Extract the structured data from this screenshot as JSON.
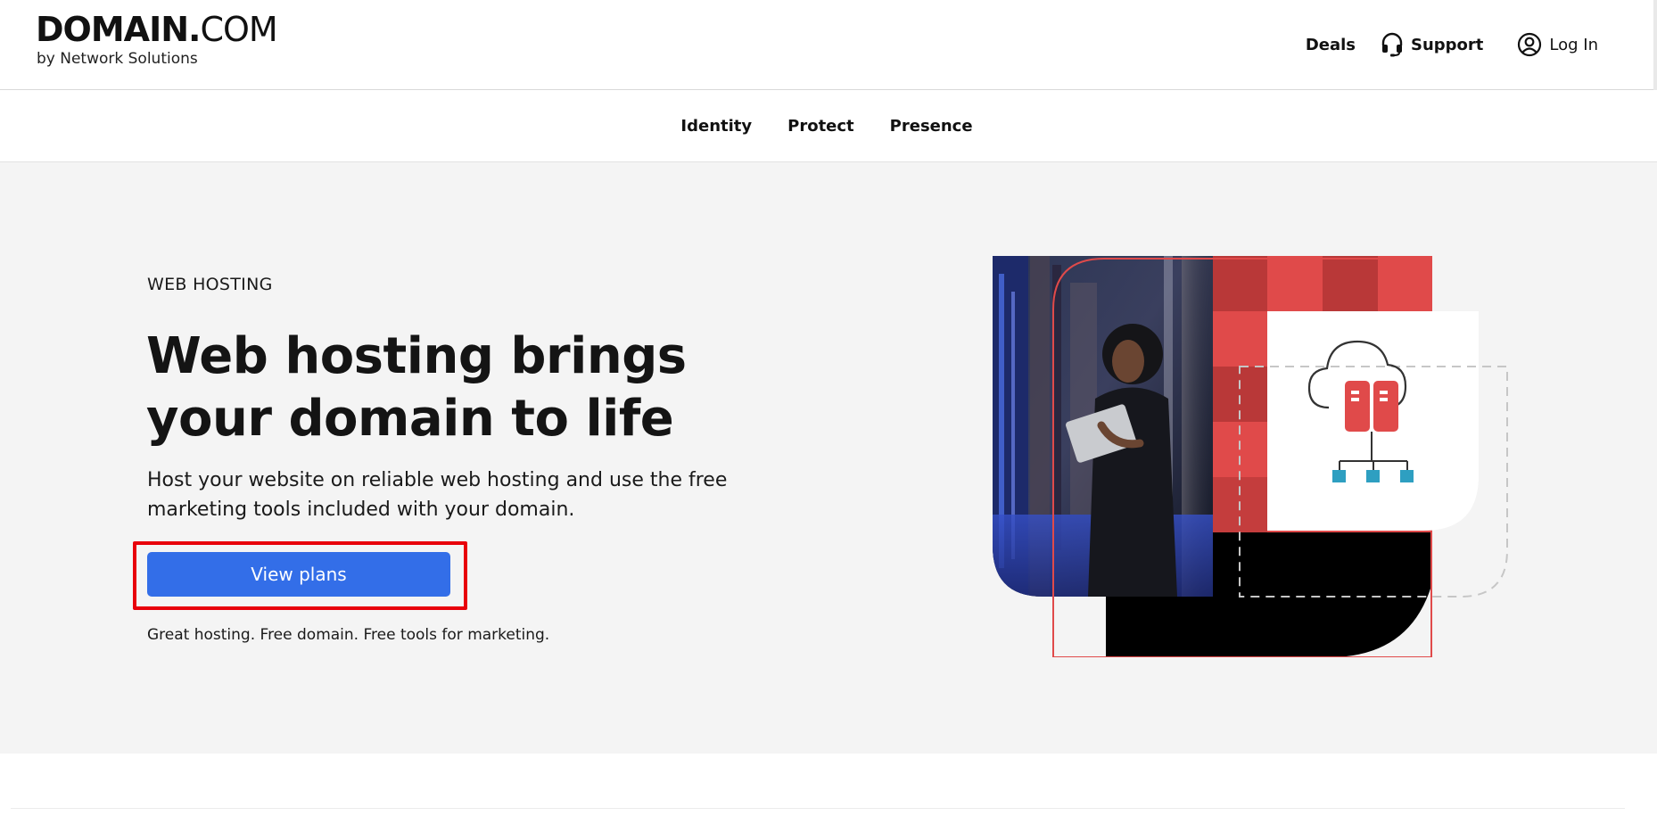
{
  "header": {
    "logo_main_bold": "DOMAIN.",
    "logo_main_light": "COM",
    "logo_sub": "by Network Solutions",
    "deals_label": "Deals",
    "support_label": "Support",
    "login_label": "Log In"
  },
  "subnav": {
    "items": [
      "Identity",
      "Protect",
      "Presence"
    ]
  },
  "hero": {
    "eyebrow": "WEB HOSTING",
    "title": "Web hosting brings your domain to life",
    "description": "Host your website on reliable web hosting and use the free marketing tools included with your domain.",
    "cta_label": "View plans",
    "tagline": "Great hosting. Free domain. Free tools for marketing."
  },
  "colors": {
    "accent_blue": "#336ee8",
    "highlight_red": "#e8000b",
    "brand_red": "#e04a4a",
    "server_teal": "#2e9fc1",
    "hero_bg": "#f4f4f4"
  },
  "icons": {
    "support": "headset-icon",
    "login": "user-circle-icon",
    "hero_art": "cloud-server-network-icon"
  }
}
